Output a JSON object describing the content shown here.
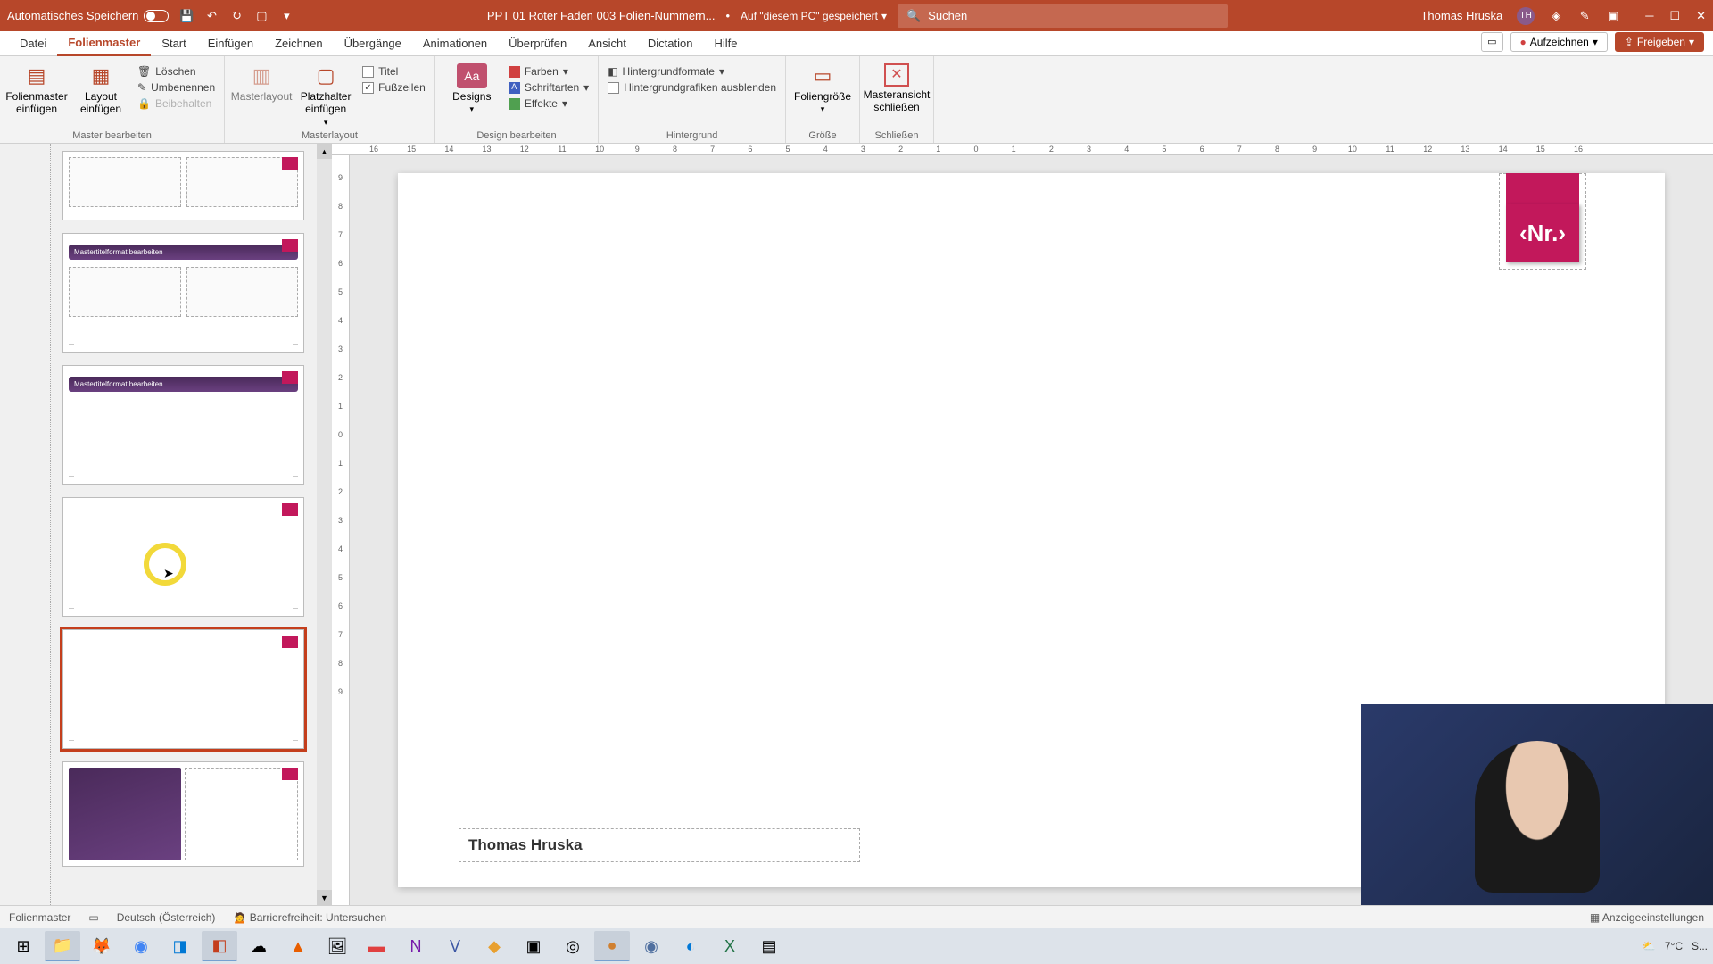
{
  "titlebar": {
    "autosave": "Automatisches Speichern",
    "doctitle": "PPT 01 Roter Faden 003 Folien-Nummern...",
    "saved_bullet": "•",
    "saved_loc": "Auf \"diesem PC\" gespeichert",
    "search_placeholder": "Suchen",
    "username": "Thomas Hruska",
    "user_initials": "TH"
  },
  "tabs": {
    "datei": "Datei",
    "folienmaster": "Folienmaster",
    "start": "Start",
    "einfuegen": "Einfügen",
    "zeichnen": "Zeichnen",
    "uebergaenge": "Übergänge",
    "animationen": "Animationen",
    "ueberpruefen": "Überprüfen",
    "ansicht": "Ansicht",
    "dictation": "Dictation",
    "hilfe": "Hilfe"
  },
  "header_actions": {
    "record": "Aufzeichnen",
    "share": "Freigeben"
  },
  "ribbon": {
    "group1": {
      "insert_master": "Folienmaster einfügen",
      "insert_layout": "Layout einfügen",
      "delete": "Löschen",
      "rename": "Umbenennen",
      "preserve": "Beibehalten",
      "label": "Master bearbeiten"
    },
    "group2": {
      "masterlayout": "Masterlayout",
      "placeholder": "Platzhalter einfügen",
      "title_chk": "Titel",
      "footer_chk": "Fußzeilen",
      "label": "Masterlayout"
    },
    "group3": {
      "designs": "Designs",
      "colors": "Farben",
      "fonts": "Schriftarten",
      "effects": "Effekte",
      "label": "Design bearbeiten"
    },
    "group4": {
      "bg_formats": "Hintergrundformate",
      "hide_bg": "Hintergrundgrafiken ausblenden",
      "label": "Hintergrund"
    },
    "group5": {
      "slide_size": "Foliengröße",
      "label": "Größe"
    },
    "group6": {
      "close_master": "Masteransicht schließen",
      "label": "Schließen"
    }
  },
  "thumbs": {
    "title_text": "Mastertitelformat bearbeiten"
  },
  "ruler_h": [
    "16",
    "15",
    "14",
    "13",
    "12",
    "11",
    "10",
    "9",
    "8",
    "7",
    "6",
    "5",
    "4",
    "3",
    "2",
    "1",
    "0",
    "1",
    "2",
    "3",
    "4",
    "5",
    "6",
    "7",
    "8",
    "9",
    "10",
    "11",
    "12",
    "13",
    "14",
    "15",
    "16"
  ],
  "ruler_v": [
    "9",
    "8",
    "7",
    "6",
    "5",
    "4",
    "3",
    "2",
    "1",
    "0",
    "1",
    "2",
    "3",
    "4",
    "5",
    "6",
    "7",
    "8",
    "9"
  ],
  "slide": {
    "page_num_placeholder": "‹Nr.›",
    "footer_author": "Thomas Hruska"
  },
  "statusbar": {
    "view": "Folienmaster",
    "lang": "Deutsch (Österreich)",
    "accessibility": "Barrierefreiheit: Untersuchen",
    "display": "Anzeigeeinstellungen"
  },
  "taskbar": {
    "weather_temp": "7°C",
    "weather_cond": "S..."
  }
}
